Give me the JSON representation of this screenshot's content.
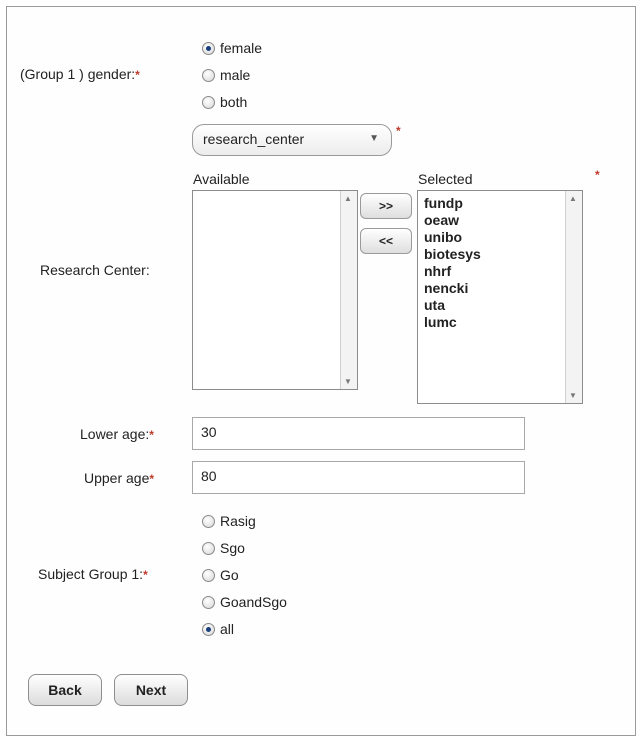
{
  "gender": {
    "label": "(Group 1 ) gender:",
    "required_mark": "*",
    "options": [
      {
        "label": "female",
        "checked": true
      },
      {
        "label": "male",
        "checked": false
      },
      {
        "label": "both",
        "checked": false
      }
    ]
  },
  "group_by_select": {
    "value": "research_center",
    "required_mark": "*"
  },
  "research_center": {
    "label": "Research Center:",
    "available_caption": "Available",
    "selected_caption": "Selected",
    "required_mark": "*",
    "available_items": [],
    "selected_items": [
      "fundp",
      "oeaw",
      "unibo",
      "biotesys",
      "nhrf",
      "nencki",
      "uta",
      "lumc"
    ],
    "add_button": ">>",
    "remove_button": "<<"
  },
  "lower_age": {
    "label": "Lower age:",
    "required_mark": "*",
    "value": "30"
  },
  "upper_age": {
    "label": "Upper age",
    "required_mark": "*",
    "value": "80"
  },
  "subject_group": {
    "label": "Subject Group 1:",
    "required_mark": "*",
    "options": [
      {
        "label": "Rasig",
        "checked": false
      },
      {
        "label": "Sgo",
        "checked": false
      },
      {
        "label": "Go",
        "checked": false
      },
      {
        "label": "GoandSgo",
        "checked": false
      },
      {
        "label": "all",
        "checked": true
      }
    ]
  },
  "nav": {
    "back_label": "Back",
    "next_label": "Next"
  },
  "colors": {
    "required": "#c0392b",
    "radio_dot": "#1a3e7a"
  }
}
